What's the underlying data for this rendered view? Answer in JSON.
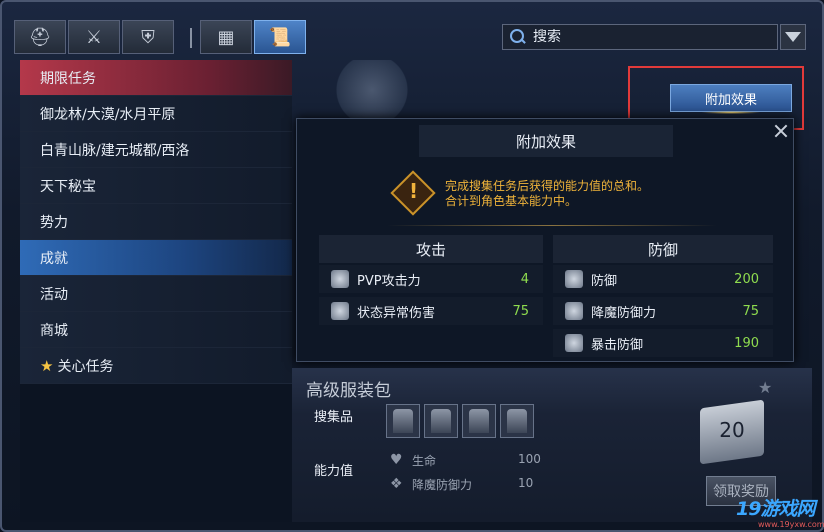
{
  "search": {
    "placeholder": "搜索"
  },
  "sidebar": {
    "items": [
      {
        "label": "期限任务"
      },
      {
        "label": "御龙林/大漠/水月平原"
      },
      {
        "label": "白青山脉/建元城都/西洛"
      },
      {
        "label": "天下秘宝"
      },
      {
        "label": "势力"
      },
      {
        "label": "成就"
      },
      {
        "label": "活动"
      },
      {
        "label": "商城"
      },
      {
        "label": "关心任务"
      }
    ]
  },
  "effect_button": {
    "label": "附加效果"
  },
  "popup": {
    "title": "附加效果",
    "description_line1": "完成搜集任务后获得的能力值的总和。",
    "description_line2": "合计到角色基本能力中。",
    "attack": {
      "header": "攻击",
      "stats": [
        {
          "label": "PVP攻击力",
          "value": "4"
        },
        {
          "label": "状态异常伤害",
          "value": "75"
        }
      ]
    },
    "defense": {
      "header": "防御",
      "stats": [
        {
          "label": "防御",
          "value": "200"
        },
        {
          "label": "降魔防御力",
          "value": "75"
        },
        {
          "label": "暴击防御",
          "value": "190"
        }
      ]
    }
  },
  "costume": {
    "title": "高级服装包",
    "collect_label": "搜集品",
    "ability_label": "能力值",
    "abilities": [
      {
        "label": "生命",
        "value": "100"
      },
      {
        "label": "降魔防御力",
        "value": "10"
      }
    ],
    "count": "20",
    "claim_label": "领取奖励"
  },
  "watermark": {
    "main": "19游戏网",
    "sub": "www.19yxw.com"
  },
  "colors": {
    "accent": "#2f6bb7",
    "highlight": "#e23a3a",
    "value_green": "#8fdc4f",
    "warning": "#f0b43a"
  }
}
